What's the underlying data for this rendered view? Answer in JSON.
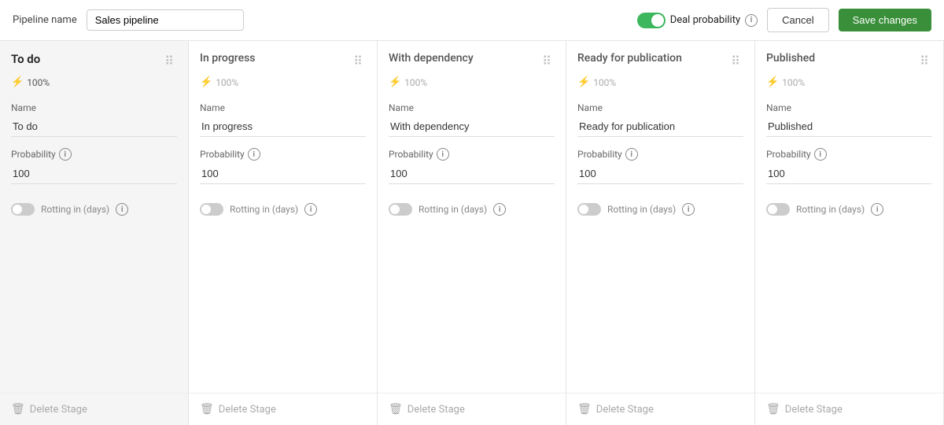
{
  "header": {
    "pipeline_label": "Pipeline name",
    "pipeline_value": "Sales pipeline",
    "deal_prob_label": "Deal probability",
    "cancel_label": "Cancel",
    "save_label": "Save changes"
  },
  "stages": [
    {
      "id": "to-do",
      "title": "To do",
      "percent": "100%",
      "selected": true,
      "name_label": "Name",
      "name_value": "To do",
      "prob_label": "Probability",
      "prob_value": "100",
      "rotting_label": "Rotting in (days)",
      "rotting_on": false,
      "delete_label": "Delete Stage"
    },
    {
      "id": "in-progress",
      "title": "In progress",
      "percent": "100%",
      "selected": false,
      "name_label": "Name",
      "name_value": "In progress",
      "prob_label": "Probability",
      "prob_value": "100",
      "rotting_label": "Rotting in (days)",
      "rotting_on": false,
      "delete_label": "Delete Stage"
    },
    {
      "id": "with-dependency",
      "title": "With dependency",
      "percent": "100%",
      "selected": false,
      "name_label": "Name",
      "name_value": "With dependency",
      "prob_label": "Probability",
      "prob_value": "100",
      "rotting_label": "Rotting in (days)",
      "rotting_on": false,
      "delete_label": "Delete Stage"
    },
    {
      "id": "ready-publication",
      "title": "Ready for publication",
      "percent": "100%",
      "selected": false,
      "name_label": "Name",
      "name_value": "Ready for publication",
      "prob_label": "Probability",
      "prob_value": "100",
      "rotting_label": "Rotting in (days)",
      "rotting_on": false,
      "delete_label": "Delete Stage"
    },
    {
      "id": "published",
      "title": "Published",
      "percent": "100%",
      "selected": false,
      "name_label": "Name",
      "name_value": "Published",
      "prob_label": "Probability",
      "prob_value": "100",
      "rotting_label": "Rotting in (days)",
      "rotting_on": false,
      "delete_label": "Delete Stage"
    }
  ]
}
